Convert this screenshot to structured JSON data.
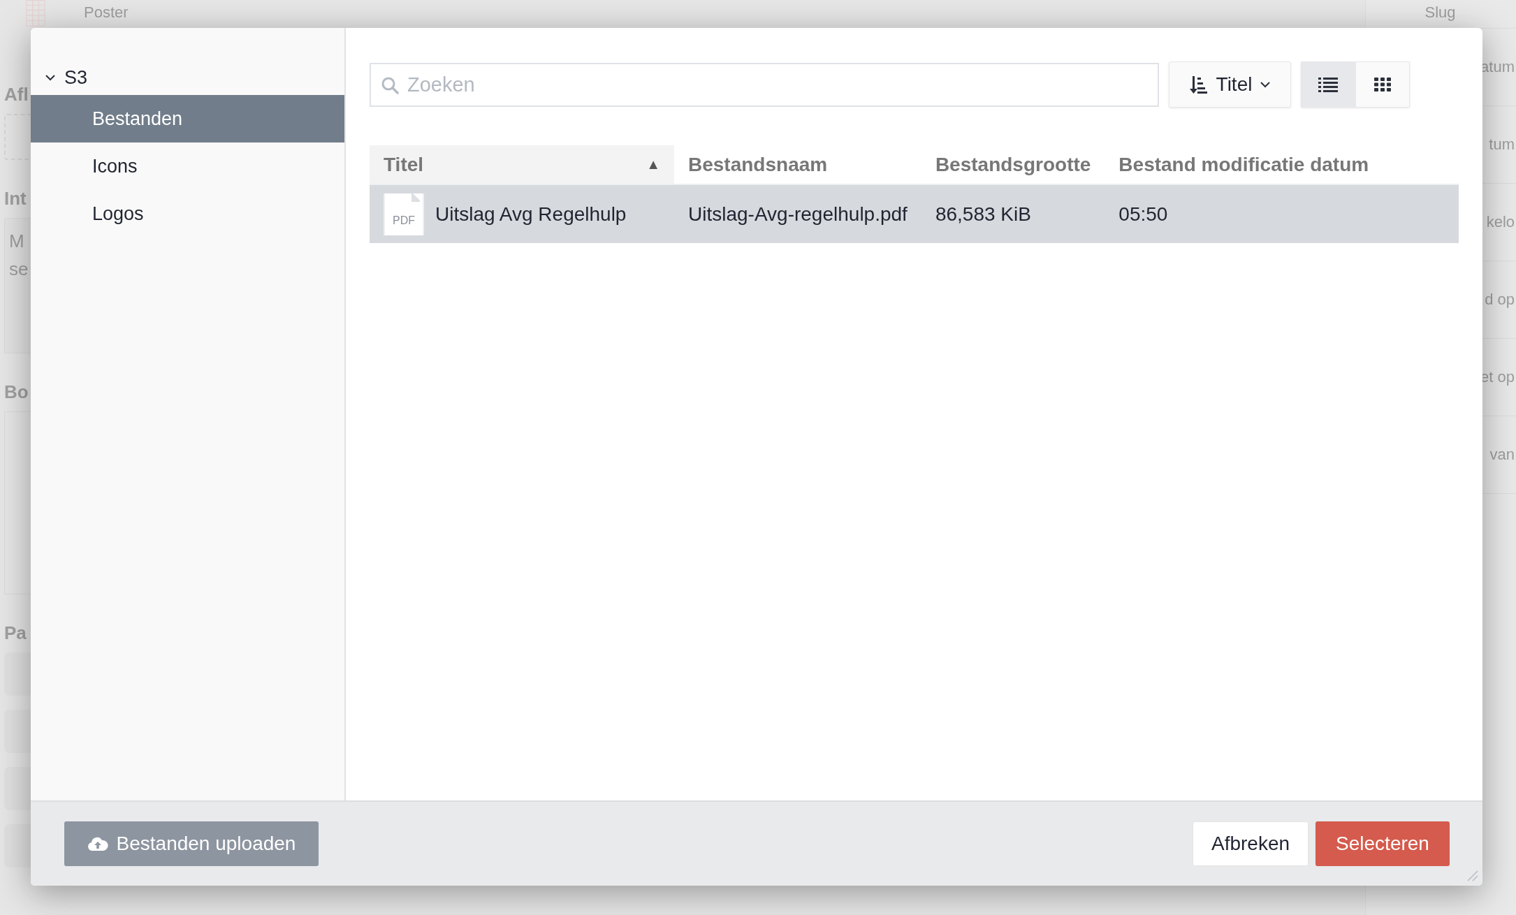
{
  "background": {
    "tab_title": "Poster",
    "left": [
      {
        "kind": "heading",
        "text": "Afl"
      },
      {
        "kind": "dropzone"
      },
      {
        "kind": "heading",
        "text": "Int"
      },
      {
        "kind": "textarea",
        "lines": [
          "M",
          "se"
        ]
      },
      {
        "kind": "heading",
        "text": "Bo"
      },
      {
        "kind": "box"
      },
      {
        "kind": "heading",
        "text": "Pa"
      },
      {
        "kind": "checkrow"
      },
      {
        "kind": "checkrow"
      },
      {
        "kind": "checkrow"
      },
      {
        "kind": "checkrow"
      }
    ],
    "right": [
      "Slug",
      "atum",
      "tum",
      "kelo",
      "d op",
      "et op",
      "van"
    ]
  },
  "tree": {
    "label": "S3",
    "expanded": true,
    "children": [
      {
        "label": "Bestanden",
        "selected": true
      },
      {
        "label": "Icons",
        "selected": false
      },
      {
        "label": "Logos",
        "selected": false
      }
    ]
  },
  "search": {
    "placeholder": "Zoeken"
  },
  "sort_button": {
    "label": "Titel"
  },
  "view_toggles": [
    {
      "kind": "list",
      "selected": true
    },
    {
      "kind": "grid",
      "selected": false
    }
  ],
  "table": {
    "columns": [
      {
        "label": "Titel",
        "sort_icon": "▲"
      },
      {
        "label": "Bestandsnaam"
      },
      {
        "label": "Bestandsgrootte"
      },
      {
        "label": "Bestand modificatie datum"
      }
    ],
    "rows": [
      {
        "file_type": "PDF",
        "title": "Uitslag Avg Regelhulp",
        "filename": "Uitslag-Avg-regelhulp.pdf",
        "size": "86,583 KiB",
        "modified": "05:50",
        "selected": true
      }
    ]
  },
  "footer": {
    "upload": "Bestanden uploaden",
    "cancel": "Afbreken",
    "confirm": "Selecteren"
  }
}
